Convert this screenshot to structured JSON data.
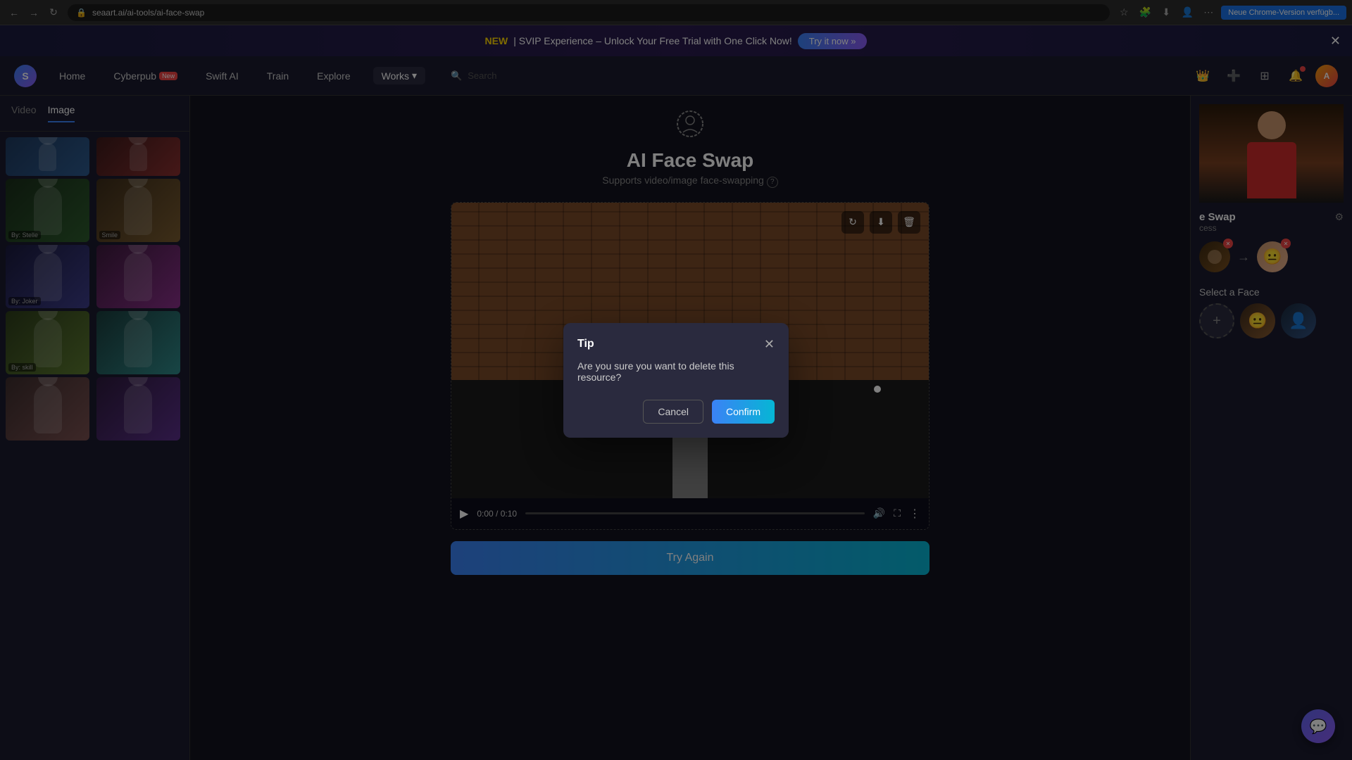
{
  "browser": {
    "url": "seaart.ai/ai-tools/ai-face-swap",
    "update_button": "Neue Chrome-Version verfügb..."
  },
  "banner": {
    "text_new": "NEW",
    "text_main": "| SVIP Experience – Unlock Your Free Trial with One Click Now!",
    "try_now": "Try it now »"
  },
  "navbar": {
    "home": "Home",
    "cyberpub": "Cyberpub",
    "cyberpub_new": "New",
    "swift_ai": "Swift AI",
    "train": "Train",
    "explore": "Explore",
    "works": "Works",
    "search_placeholder": "Search"
  },
  "tabs": {
    "video": "Video",
    "image": "Image"
  },
  "tool": {
    "title": "AI Face Swap",
    "subtitle": "Supports video/image face-swapping"
  },
  "video_player": {
    "time_current": "0:00",
    "time_total": "0:10"
  },
  "buttons": {
    "try_again": "Try Again",
    "cancel": "Cancel",
    "confirm": "Confirm"
  },
  "modal": {
    "title": "Tip",
    "message": "Are you sure you want to delete this resource?"
  },
  "right_panel": {
    "face_swap_label": "e Swap",
    "process_label": "cess",
    "select_face": "Select a Face"
  },
  "sidebar_items": [
    {
      "by": "By: Stelle",
      "id": 1
    },
    {
      "by": "Smile",
      "id": 2
    },
    {
      "by": "By: Joker",
      "id": 3
    },
    {
      "by": "",
      "id": 4
    },
    {
      "by": "By: skill",
      "id": 5
    },
    {
      "by": "",
      "id": 6
    },
    {
      "by": "",
      "id": 7
    },
    {
      "by": "",
      "id": 8
    }
  ]
}
